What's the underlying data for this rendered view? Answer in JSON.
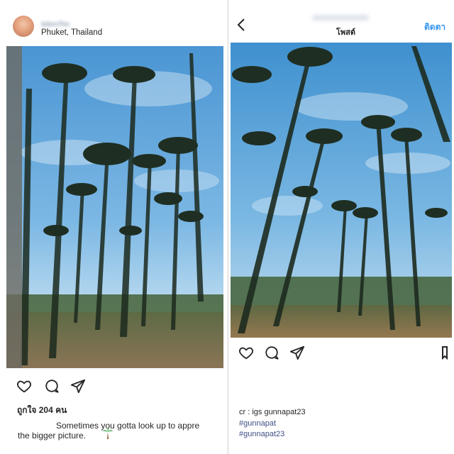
{
  "left_post": {
    "username": "แมะchu",
    "location": "Phuket, Thailand",
    "likes": "ถูกใจ 204 คน",
    "caption_line1": "Sometimes you gotta look up to appre",
    "caption_line2": "the bigger picture.",
    "caption_emoji": "palm-tree-icon"
  },
  "right_post": {
    "title": "โพสต์",
    "follow": "ติดตา",
    "credit": "cr : igs gunnapat23",
    "hashtags": [
      "#gunnapat",
      "#gunnapat23"
    ]
  },
  "colors": {
    "sky_top": "#4d9bd8",
    "sky_bottom": "#a9d3ee",
    "ground": "#7d6a4c",
    "link_blue": "#3897f0",
    "hashtag_blue": "#3f4f86"
  },
  "icons": [
    "heart-icon",
    "comment-icon",
    "share-icon",
    "back-chevron-icon",
    "bookmark-icon"
  ]
}
